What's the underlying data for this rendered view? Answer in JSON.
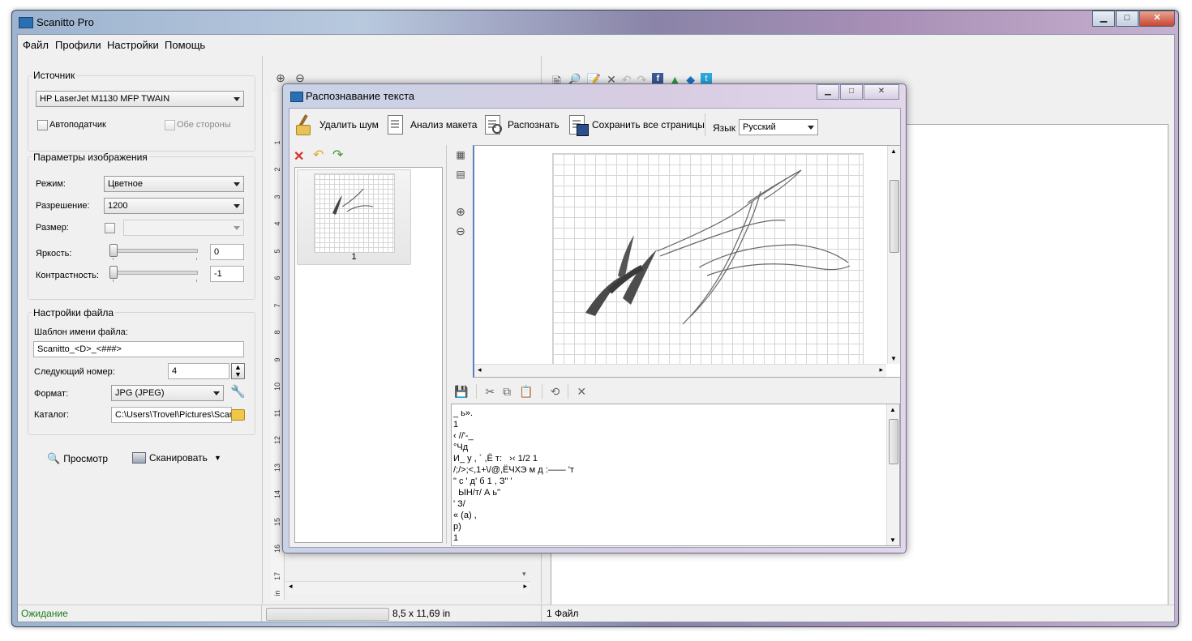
{
  "window": {
    "title": "Scanitto Pro",
    "min": "▁",
    "max": "□",
    "close": "✕"
  },
  "menu": [
    "Файл",
    "Профили",
    "Настройки",
    "Помощь"
  ],
  "source": {
    "group_label": "Источник",
    "device": "HP LaserJet M1130 MFP TWAIN",
    "adf_label": "Автоподатчик",
    "duplex_label": "Обе стороны"
  },
  "image_params": {
    "group_label": "Параметры изображения",
    "mode_label": "Режим:",
    "mode_value": "Цветное",
    "resolution_label": "Разрешение:",
    "resolution_value": "1200",
    "size_label": "Размер:",
    "brightness_label": "Яркость:",
    "brightness_value": "0",
    "contrast_label": "Контрастность:",
    "contrast_value": "-1"
  },
  "file_settings": {
    "group_label": "Настройки файла",
    "template_label": "Шаблон имени файла:",
    "template_value": "Scanitto_<D>_<###>",
    "next_number_label": "Следующий номер:",
    "next_number_value": "4",
    "format_label": "Формат:",
    "format_value": "JPG (JPEG)",
    "catalog_label": "Каталог:",
    "catalog_value": "C:\\Users\\Trovel\\Pictures\\Scan"
  },
  "actions": {
    "preview": "Просмотр",
    "scan": "Сканировать"
  },
  "ruler_numbers": [
    "1",
    "2",
    "3",
    "4",
    "5",
    "6",
    "7",
    "8",
    "9",
    "10",
    "11",
    "12",
    "13",
    "14",
    "15",
    "16",
    "17"
  ],
  "ruler_unit": "in",
  "status": {
    "state": "Ожидание",
    "page_size": "8,5 x 11,69 in",
    "files": "1 Файл"
  },
  "ocr_dialog": {
    "title": "Распознавание текста",
    "toolbar": {
      "denoise": "Удалить шум",
      "layout": "Анализ макета",
      "recognize": "Распознать",
      "save_all": "Сохранить все страницы",
      "language_label": "Язык",
      "language_value": "Русский"
    },
    "thumbnail_label": "1",
    "ocr_text": [
      "_ ь».",
      "1",
      "‹ //'-_",
      "°Чд",
      "И_ у , ` ,Ё т:   ›‹ 1/2 1",
      "/;/>;<,1+\\/@,ЁЧХЭ м д :—— 'т",
      "\" с ' д' б 1 , З\" '",
      "  ЫН/т/ А ь\"",
      "' З/",
      "« (а) ,",
      "р)",
      "1"
    ]
  },
  "colors": {
    "status_green": "#1a7d1a",
    "titlebar_blue": "#9db3cf",
    "dialog_lilac": "#d8cce2"
  }
}
